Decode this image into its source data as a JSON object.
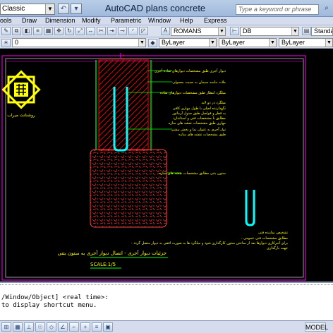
{
  "titlebar": {
    "workspace": "Classic",
    "title": "AutoCAD plans concrete columns.dwg",
    "search_placeholder": "Type a keyword or phrase"
  },
  "menu": [
    "ools",
    "Draw",
    "Dimension",
    "Modify",
    "Parametric",
    "Window",
    "Help",
    "Express"
  ],
  "toolbar": {
    "text_style": "ROMANS",
    "dim_style": "DB",
    "table_style": "Standard",
    "layer_value": "0",
    "color": "ByLayer",
    "linetype": "ByLayer",
    "lineweight": "ByLayer"
  },
  "drawing": {
    "logo_caption": "روشنانت میراب",
    "note1": "دیوار آجری طبق مشخصات دیوارهای ساده آجری",
    "note2": "ملات ماسه سیمان به نسبت معمولی",
    "note3": "میلگرد انتظار طبق مشخصات دیوارهای ساده",
    "note4_title": "میلگرد در دو لایه",
    "note4_lines": [
      "نگهدارنده اصلی با طول مهاری کافی",
      "به قطر و فواصل طبق جدول آرماتور",
      "مطابق با مشخصات فنی و استاندارد",
      "مهاری طبق مشخصات نقشه های سازه"
    ],
    "note5": "نوار آجری به عنوان نما و بخش بیشتر",
    "note6": "طبق مشخصات نقشه های سازه",
    "note7": "ستون بتنی مطابق مشخصات نقشه های سازه",
    "bottom_note_title": "تشخیص نماینده فنی",
    "bottom_note_lines": [
      "- مطابق مشخصات فنی عمومی",
      "- برای آجرکاری دیوارها بعد از ساختن ستون کارگذاری شود و میلگرد ها به صورت افقی به دیوار متصل گردد",
      "جهت بارگذاری"
    ],
    "caption": "جزئیات دیوار آجری - اتصال دیوار آجری به ستون بتنی",
    "scale": "SCALE:1/5"
  },
  "command": {
    "line1": "/Window/Object] <real time>:",
    "line2": "to display shortcut menu."
  },
  "status": {
    "model": "MODEL"
  },
  "colors": {
    "border_magenta": "#ff00ff",
    "wall_red": "#ff0000",
    "rebar_cyan": "#00ffff",
    "text_yellow": "#ffff00",
    "leader_green": "#00ff00"
  }
}
